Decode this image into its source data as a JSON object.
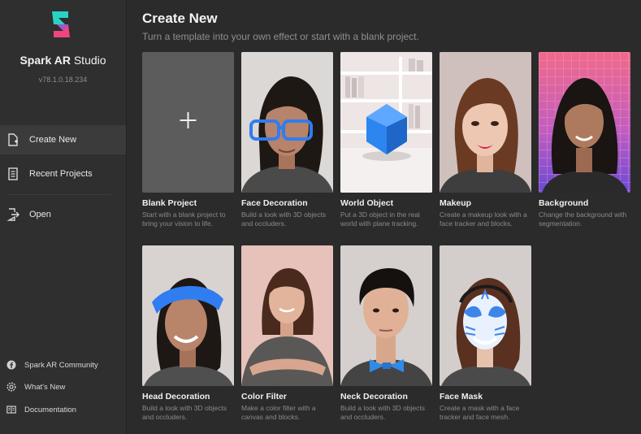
{
  "app": {
    "name_bold": "Spark AR",
    "name_light": " Studio",
    "version": "v78.1.0.18.234"
  },
  "nav": [
    {
      "label": "Create New",
      "icon": "new-file-icon",
      "active": true
    },
    {
      "label": "Recent Projects",
      "icon": "document-icon",
      "active": false
    },
    {
      "label": "Open",
      "icon": "open-icon",
      "active": false
    }
  ],
  "footer_links": [
    {
      "label": "Spark AR Community",
      "icon": "facebook-icon"
    },
    {
      "label": "What's New",
      "icon": "settings-icon"
    },
    {
      "label": "Documentation",
      "icon": "book-icon"
    }
  ],
  "main": {
    "title": "Create New",
    "subtitle": "Turn a template into your own effect or start with a blank project."
  },
  "templates": [
    {
      "title": "Blank Project",
      "desc": "Start with a blank project to bring your vision to life."
    },
    {
      "title": "Face Decoration",
      "desc": "Build a look with 3D objects and occluders."
    },
    {
      "title": "World Object",
      "desc": "Put a 3D object in the real world with plane tracking."
    },
    {
      "title": "Makeup",
      "desc": "Create a makeup look with a face tracker and blocks."
    },
    {
      "title": "Background",
      "desc": "Change the background with segmentation."
    },
    {
      "title": "Head Decoration",
      "desc": "Build a look with 3D objects and occluders."
    },
    {
      "title": "Color Filter",
      "desc": "Make a color filter with a canvas and blocks."
    },
    {
      "title": "Neck Decoration",
      "desc": "Build a look with 3D objects and occluders."
    },
    {
      "title": "Face Mask",
      "desc": "Create a mask with a face tracker and face mesh."
    }
  ],
  "colors": {
    "sidebar": "#2f2f2f",
    "main": "#2b2b2b",
    "active_nav": "#3b3b3b",
    "logo_teal": "#2ad3c1",
    "logo_pink": "#f0457f"
  }
}
